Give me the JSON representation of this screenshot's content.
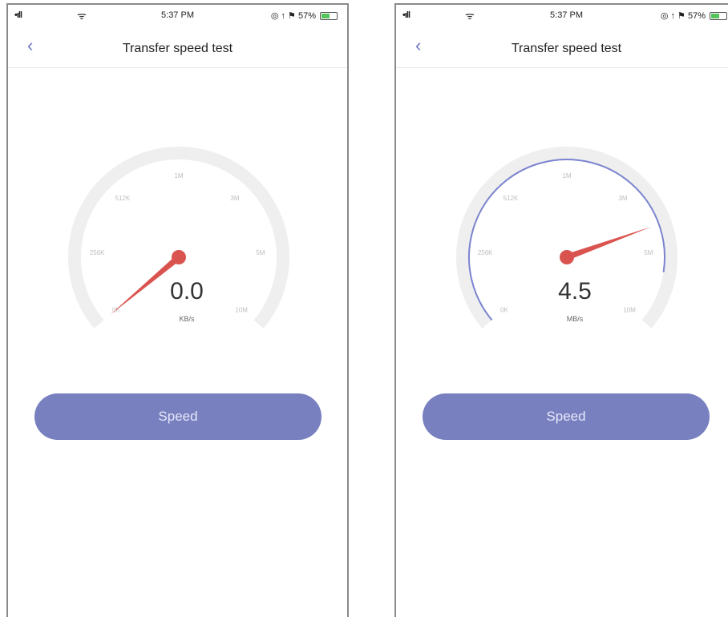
{
  "screens": [
    {
      "status": {
        "signal": "•ıll",
        "wifi": "ᯤ",
        "time": "5:37 PM",
        "right_icons": "◎ ↑ ⚑ 57%",
        "battery_pct": 57
      },
      "nav": {
        "back": "‹",
        "title": "Transfer speed test"
      },
      "gauge": {
        "ticks": [
          "0K",
          "256K",
          "512K",
          "1M",
          "3M",
          "5M",
          "10M"
        ],
        "value_text": "0.0",
        "unit": "KB/s",
        "needle_fraction": 0.0,
        "progress_fraction": 0.0,
        "track_color": "#efefef",
        "progress_color": "#7a84cf",
        "needle_color": "#d9534f"
      },
      "button": {
        "label": "Speed"
      }
    },
    {
      "status": {
        "signal": "•ıll",
        "wifi": "ᯤ",
        "time": "5:37 PM",
        "right_icons": "◎ ↑ ⚑ 57%",
        "battery_pct": 57
      },
      "nav": {
        "back": "‹",
        "title": "Transfer speed test"
      },
      "gauge": {
        "ticks": [
          "0K",
          "256K",
          "512K",
          "1M",
          "3M",
          "5M",
          "10M"
        ],
        "value_text": "4.5",
        "unit": "MB/s",
        "needle_fraction": 0.77,
        "progress_fraction": 0.88,
        "track_color": "#efefef",
        "progress_color": "#7a84cf",
        "needle_color": "#d9534f"
      },
      "button": {
        "label": "Speed"
      }
    }
  ]
}
